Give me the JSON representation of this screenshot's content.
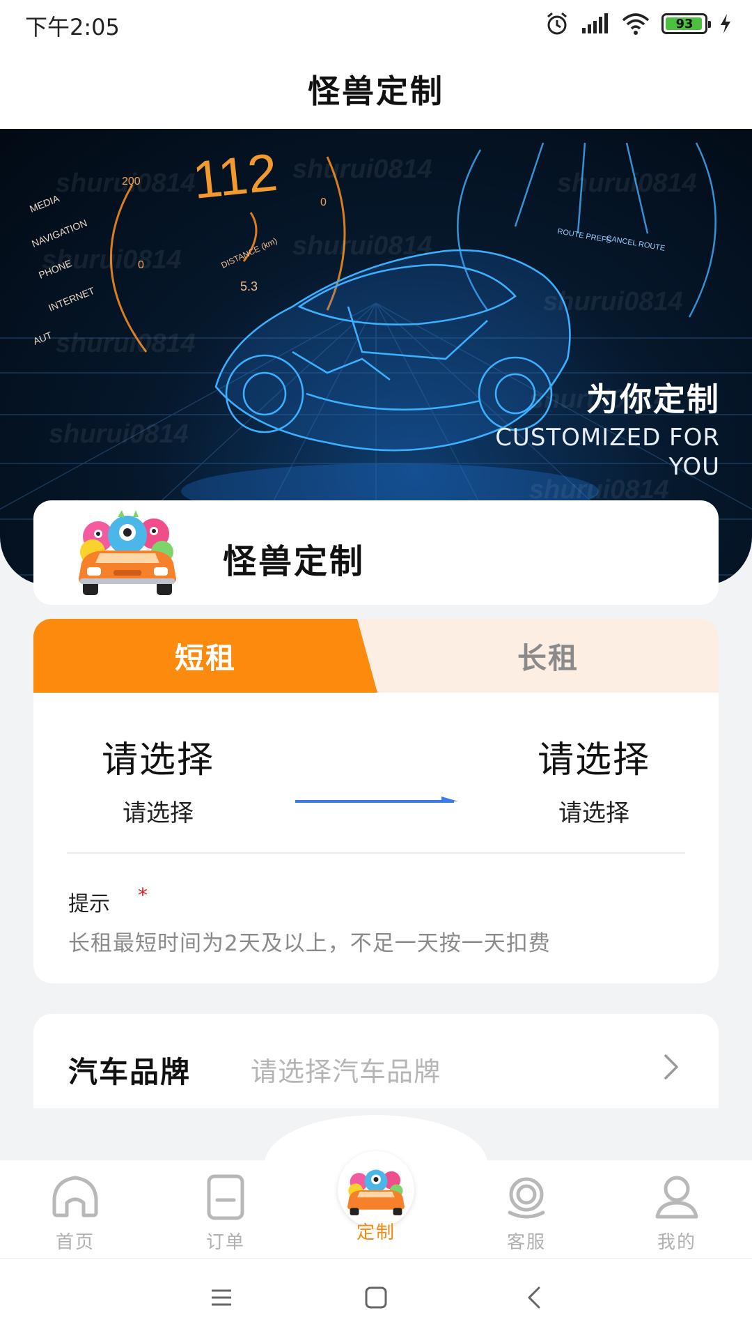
{
  "status_bar": {
    "time": "下午2:05",
    "battery": "93"
  },
  "header": {
    "title": "怪兽定制"
  },
  "banner": {
    "slogan_cn": "为你定制",
    "slogan_en": "CUSTOMIZED FOR YOU",
    "dash": {
      "speed": "112",
      "distance_label": "DISTANCE (km)",
      "distance_value": "5.3",
      "menu": [
        "MEDIA",
        "NAVIGATION",
        "PHONE",
        "INTERNET",
        "AUT"
      ],
      "route_labels": [
        "ROUTE PREFS",
        "CANCEL ROUTE"
      ]
    },
    "watermark": "shurui0814"
  },
  "brand_card": {
    "name": "怪兽定制"
  },
  "rental": {
    "tabs": [
      {
        "label": "短租",
        "active": true
      },
      {
        "label": "长租",
        "active": false
      }
    ],
    "start": {
      "title": "请选择",
      "subtitle": "请选择"
    },
    "end": {
      "title": "请选择",
      "subtitle": "请选择"
    },
    "tip_label": "提示",
    "tip_required": "*",
    "tip_text": "长租最短时间为2天及以上，不足一天按一天扣费"
  },
  "car_brand": {
    "label": "汽车品牌",
    "placeholder": "请选择汽车品牌"
  },
  "tabbar": {
    "items": [
      {
        "label": "首页",
        "icon": "home-icon",
        "active": false
      },
      {
        "label": "订单",
        "icon": "order-icon",
        "active": false
      },
      {
        "label": "定制",
        "icon": "monster-car-logo",
        "active": true
      },
      {
        "label": "客服",
        "icon": "customer-service-icon",
        "active": false
      },
      {
        "label": "我的",
        "icon": "user-icon",
        "active": false
      }
    ]
  },
  "colors": {
    "accent": "#fc8a0c",
    "tab_inactive_bg": "#fdeee3",
    "active_label": "#f08a12",
    "arrow": "#3b7be6"
  }
}
